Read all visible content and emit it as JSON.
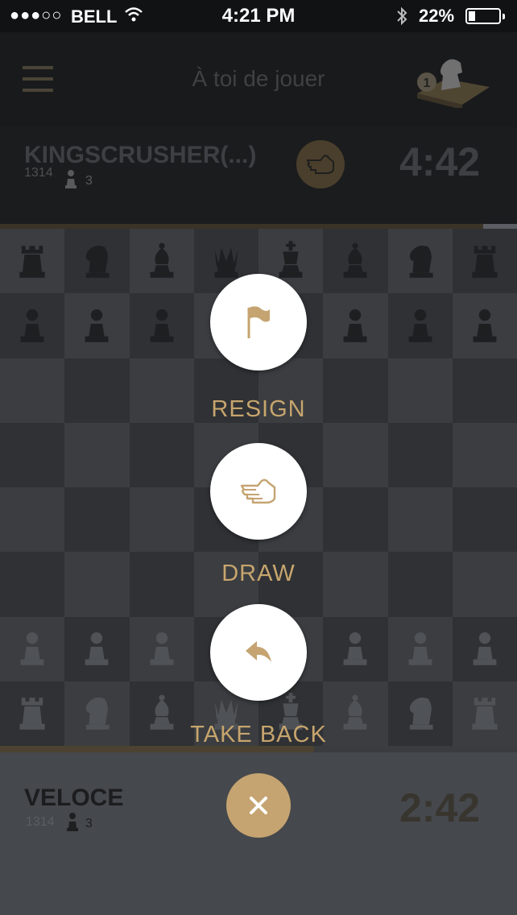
{
  "status_bar": {
    "signal": "●●●○○",
    "carrier": "BELL",
    "time": "4:21 PM",
    "battery": "22%"
  },
  "header": {
    "title": "À toi de jouer",
    "badge": "1"
  },
  "opponent": {
    "name": "KINGSCRUSHER(...)",
    "rating": "1314",
    "pieces": "3",
    "clock": "4:42"
  },
  "player": {
    "name": "VELOCE",
    "rating": "1314",
    "pieces": "3",
    "clock": "2:42"
  },
  "actions": {
    "resign": "RESIGN",
    "draw": "DRAW",
    "takeback": "TAKE BACK"
  },
  "colors": {
    "accent": "#c7a56d",
    "header_bg": "#191a1c",
    "bottom_bg": "#45484c"
  },
  "board": {
    "black_back": [
      "rook",
      "knight",
      "bishop",
      "queen",
      "king",
      "bishop",
      "knight",
      "rook"
    ],
    "white_back": [
      "rook",
      "knight",
      "bishop",
      "queen",
      "king",
      "bishop",
      "knight",
      "rook"
    ]
  }
}
